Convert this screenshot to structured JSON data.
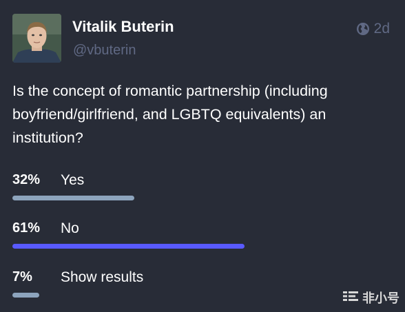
{
  "author": {
    "display_name": "Vitalik Buterin",
    "handle": "@vbuterin",
    "avatar_icon": "user-avatar"
  },
  "meta": {
    "visibility_icon": "globe-icon",
    "relative_time": "2d"
  },
  "status": {
    "text": "Is the concept of romantic partnership (including boyfriend/girlfriend, and LGBTQ equivalents) an institution?"
  },
  "poll": {
    "options": [
      {
        "percent_label": "32%",
        "label": "Yes",
        "fraction": 0.32,
        "leading": false
      },
      {
        "percent_label": "61%",
        "label": "No",
        "fraction": 0.61,
        "leading": true
      },
      {
        "percent_label": "7%",
        "label": "Show results",
        "fraction": 0.07,
        "leading": false
      }
    ]
  },
  "watermark": {
    "text": "非小号",
    "logo_icon": "feixiaohao-logo-icon"
  },
  "colors": {
    "background": "#282c37",
    "muted_text": "#606984",
    "bar_default": "#8da4bd",
    "bar_leading": "#595aff"
  }
}
